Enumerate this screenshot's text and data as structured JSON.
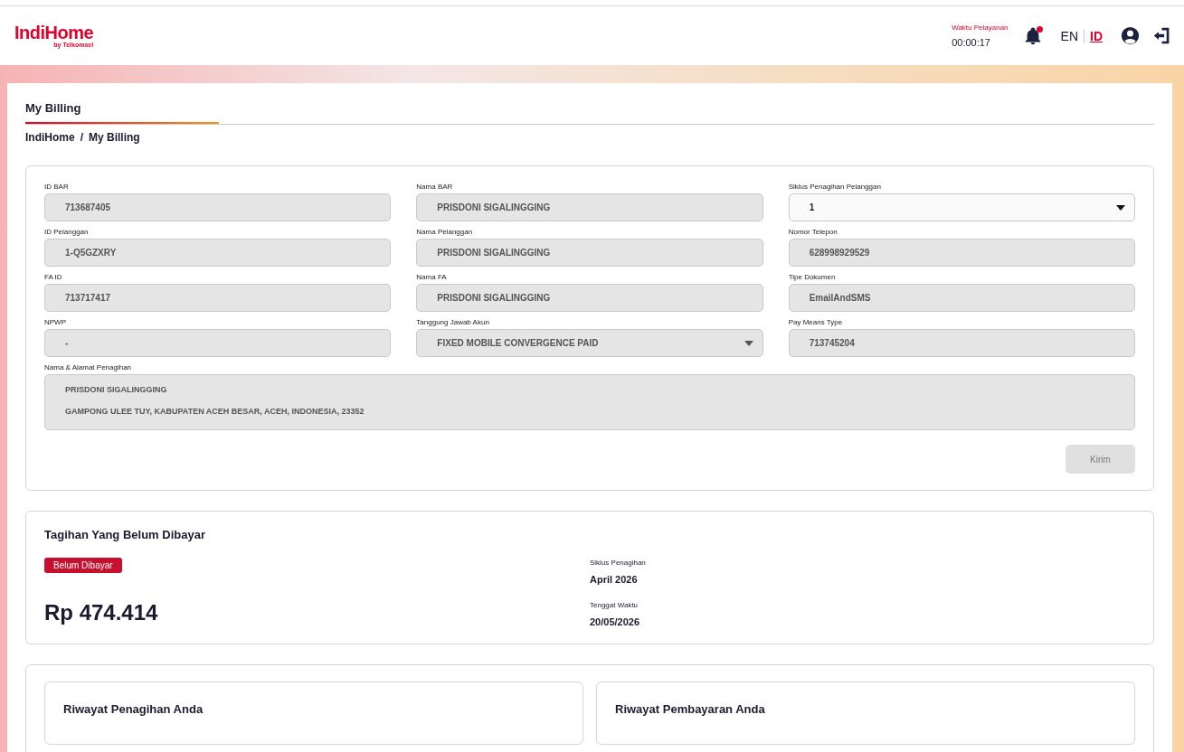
{
  "header": {
    "logo": "IndiHome",
    "logo_sub": "by Telkomsel",
    "service_time_label": "Waktu Pelayanan",
    "service_time": "00:00:17",
    "notification": true,
    "languages": [
      {
        "label": "EN",
        "selected": false
      },
      {
        "label": "ID",
        "selected": true
      }
    ]
  },
  "tabs": [
    {
      "label": "My Billing",
      "selected": true
    }
  ],
  "breadcrumb": [
    "IndiHome",
    "My Billing"
  ],
  "breadcrumb_separator": "/",
  "form": {
    "fields": [
      {
        "label": "ID BAR",
        "value": "713687405",
        "kind": "text",
        "disabled": true
      },
      {
        "label": "Nama BAR",
        "value": "PRISDONI SIGALINGGING",
        "kind": "text",
        "disabled": true
      },
      {
        "label": "Siklus Penagihan Pelanggan",
        "value": "1",
        "kind": "select",
        "disabled": false
      },
      {
        "label": "ID Pelanggan",
        "value": "1-Q5GZXRY",
        "kind": "text",
        "disabled": true
      },
      {
        "label": "Nama Pelanggan",
        "value": "PRISDONI SIGALINGGING",
        "kind": "text",
        "disabled": true
      },
      {
        "label": "Nomor Telepon",
        "value": "628998929529",
        "kind": "text",
        "disabled": true
      },
      {
        "label": "FA ID",
        "value": "713717417",
        "kind": "text",
        "disabled": true
      },
      {
        "label": "Nama FA",
        "value": "PRISDONI SIGALINGGING",
        "kind": "text",
        "disabled": true
      },
      {
        "label": "Tipe Dokumen",
        "value": "EmailAndSMS",
        "kind": "text",
        "disabled": true
      },
      {
        "label": "NPWP",
        "value": "-",
        "kind": "text",
        "disabled": true
      },
      {
        "label": "Tanggung Jawab Akun",
        "value": "FIXED MOBILE CONVERGENCE PAID",
        "kind": "select",
        "disabled": true
      },
      {
        "label": "Pay Means Type",
        "value": "713745204",
        "kind": "text",
        "disabled": true
      }
    ],
    "address": {
      "label": "Nama & Alamat Penagihan",
      "lines": [
        "PRISDONI SIGALINGGING",
        "GAMPONG ULEE TUY, KABUPATEN ACEH BESAR, ACEH, INDONESIA, 23352"
      ]
    },
    "submit": {
      "label": "Kirim",
      "disabled": true
    }
  },
  "unpaid": {
    "title": "Tagihan Yang Belum Dibayar",
    "status": "Belum Dibayar",
    "amount": "Rp 474.414",
    "details": [
      {
        "label": "Siklus Penagihan",
        "value": "April 2026"
      },
      {
        "label": "Tenggat Waktu",
        "value": "20/05/2026"
      }
    ]
  },
  "history": [
    {
      "title": "Riwayat Penagihan Anda"
    },
    {
      "title": "Riwayat Pembayaran Anda"
    }
  ]
}
